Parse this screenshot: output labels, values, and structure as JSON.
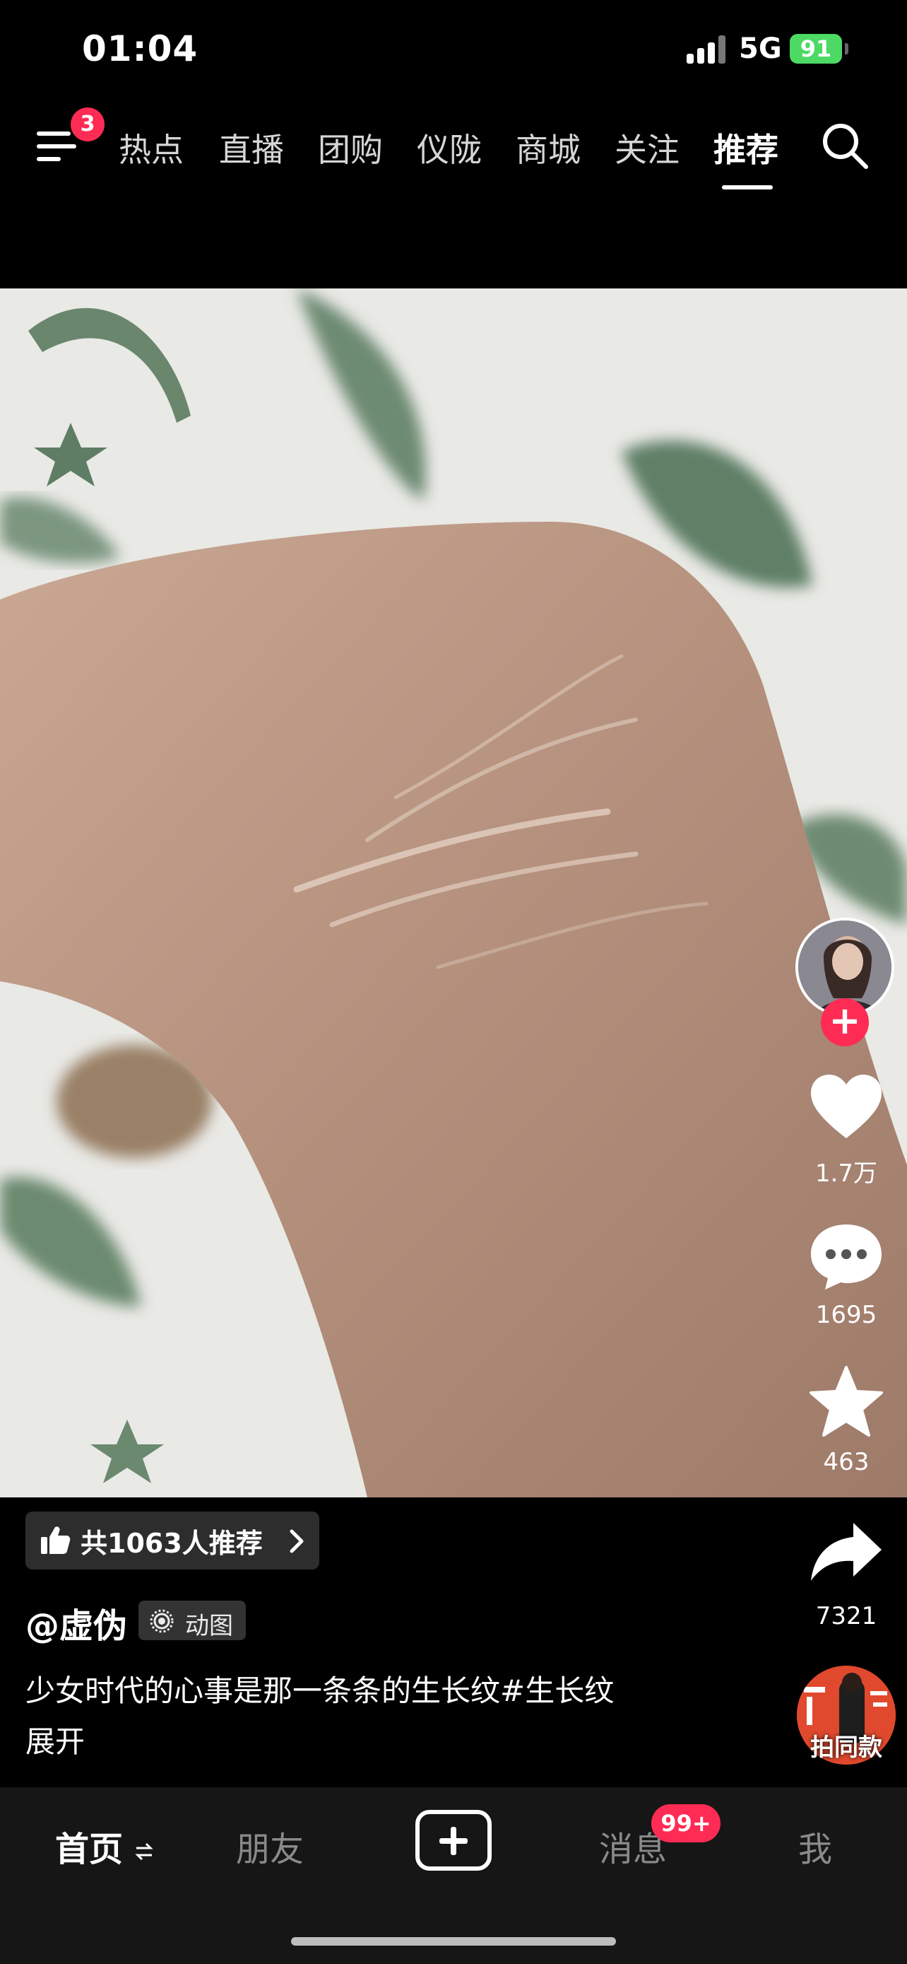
{
  "status_bar": {
    "time": "01:04",
    "network": "5G",
    "battery": "91"
  },
  "top_nav": {
    "menu_badge": "3",
    "tabs": [
      {
        "label": "热点",
        "active": false
      },
      {
        "label": "直播",
        "active": false
      },
      {
        "label": "团购",
        "active": false
      },
      {
        "label": "仪陇",
        "active": false
      },
      {
        "label": "商城",
        "active": false
      },
      {
        "label": "关注",
        "active": false
      },
      {
        "label": "推荐",
        "active": true
      }
    ]
  },
  "rail": {
    "likes": "1.7万",
    "comments": "1695",
    "favorites": "463",
    "shares": "7321",
    "same_style_label": "拍同款"
  },
  "info": {
    "recommend_text": "共1063人推荐",
    "author": "@虚伪",
    "gif_tag": "动图",
    "caption": "少女时代的心事是那一条条的生长纹#生长纹",
    "expand": "展开"
  },
  "tab_bar": {
    "home": "首页",
    "friends": "朋友",
    "messages": "消息",
    "messages_badge": "99+",
    "me": "我"
  },
  "colors": {
    "accent": "#fe2c55",
    "battery": "#4cd964"
  }
}
